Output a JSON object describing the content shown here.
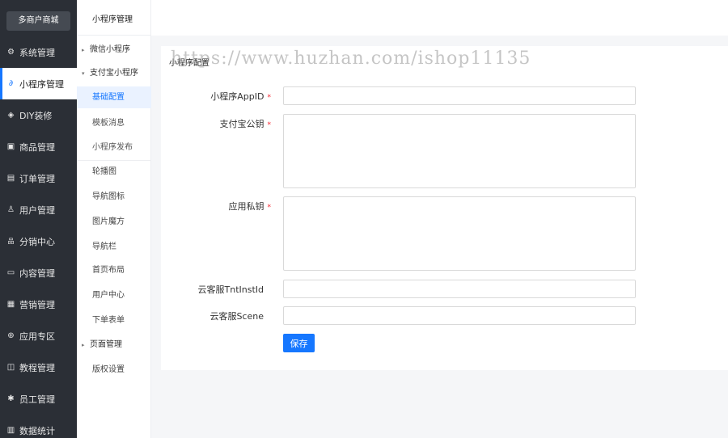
{
  "brand": {
    "logo_text": "多商户商城"
  },
  "sidebar": {
    "items": [
      {
        "label": "系统管理",
        "icon": "gear-icon",
        "glyph": "⚙"
      },
      {
        "label": "小程序管理",
        "icon": "link-icon",
        "glyph": "🔗",
        "active": true
      },
      {
        "label": "DIY装修",
        "icon": "diamond-icon",
        "glyph": "◈"
      },
      {
        "label": "商品管理",
        "icon": "box-icon",
        "glyph": "▣"
      },
      {
        "label": "订单管理",
        "icon": "list-icon",
        "glyph": "▤"
      },
      {
        "label": "用户管理",
        "icon": "user-icon",
        "glyph": "♙"
      },
      {
        "label": "分销中心",
        "icon": "org-icon",
        "glyph": "品"
      },
      {
        "label": "内容管理",
        "icon": "doc-icon",
        "glyph": "▭"
      },
      {
        "label": "营销管理",
        "icon": "coupon-icon",
        "glyph": "▦"
      },
      {
        "label": "应用专区",
        "icon": "app-icon",
        "glyph": "⊕"
      },
      {
        "label": "教程管理",
        "icon": "book-icon",
        "glyph": "◫"
      },
      {
        "label": "员工管理",
        "icon": "staff-icon",
        "glyph": "✱"
      },
      {
        "label": "数据统计",
        "icon": "chart-icon",
        "glyph": "▥"
      }
    ]
  },
  "subnav": {
    "title": "小程序管理",
    "items": [
      {
        "label": "微信小程序",
        "type": "group",
        "caret": "▸"
      },
      {
        "label": "支付宝小程序",
        "type": "group",
        "caret": "▾"
      },
      {
        "label": "基础配置",
        "active": true
      },
      {
        "label": "模板消息"
      },
      {
        "label": "小程序发布"
      },
      {
        "label": "轮播图"
      },
      {
        "label": "导航图标"
      },
      {
        "label": "图片魔方"
      },
      {
        "label": "导航栏"
      },
      {
        "label": "首页布局"
      },
      {
        "label": "用户中心"
      },
      {
        "label": "下单表单"
      },
      {
        "label": "页面管理",
        "type": "group",
        "caret": "▸"
      },
      {
        "label": "版权设置"
      }
    ]
  },
  "panel": {
    "title": "小程序配置",
    "watermark": "https://www.huzhan.com/ishop11135"
  },
  "form": {
    "appid_label": "小程序AppID",
    "alipay_pubkey_label": "支付宝公钥",
    "app_privkey_label": "应用私钥",
    "tnt_label": "云客服TntInstId",
    "scene_label": "云客服Scene",
    "required_mark": "*",
    "appid_value": "",
    "tnt_value": "",
    "scene_value": "",
    "save_label": "保存"
  },
  "colors": {
    "accent": "#1677ff",
    "sidebar_bg": "#2b2f36",
    "required": "#f5222d"
  }
}
